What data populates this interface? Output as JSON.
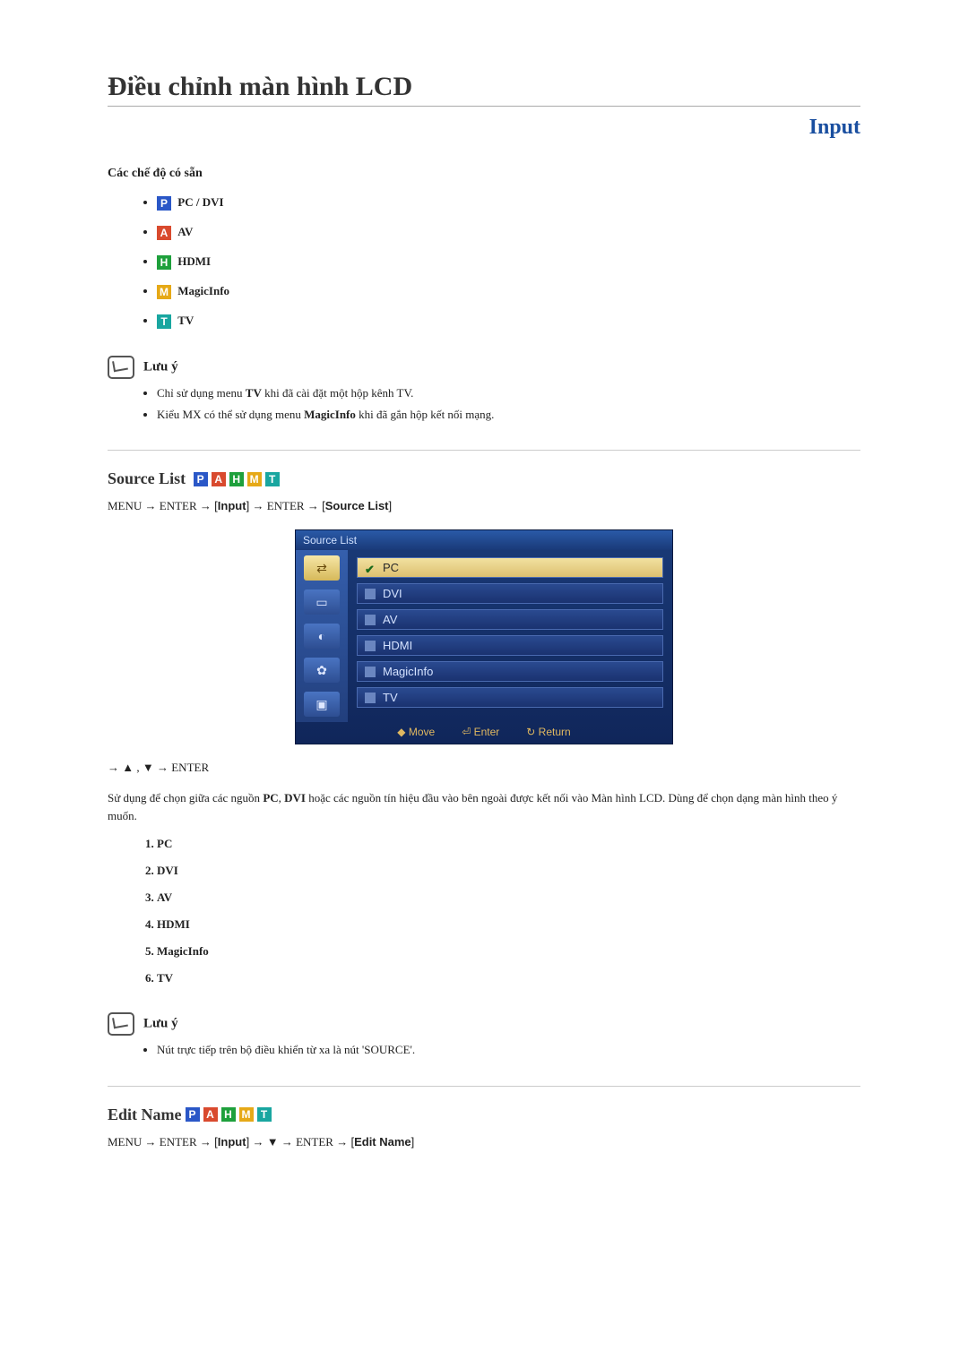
{
  "title": "Điều chỉnh màn hình LCD",
  "inputTitle": "Input",
  "modesHeading": "Các chế độ có sẵn",
  "modes": [
    {
      "key": "P",
      "label": "PC / DVI"
    },
    {
      "key": "A",
      "label": "AV"
    },
    {
      "key": "H",
      "label": "HDMI"
    },
    {
      "key": "M",
      "label": "MagicInfo"
    },
    {
      "key": "T",
      "label": "TV"
    }
  ],
  "note1": {
    "title": "Lưu ý",
    "items": [
      {
        "pre": "Chỉ sử dụng menu ",
        "bold1": "TV",
        "mid": " khi đã cài đặt một hộp kênh TV.",
        "bold2": "",
        "post": ""
      },
      {
        "pre": "Kiểu MX có thể sử dụng menu ",
        "bold1": "MagicInfo",
        "mid": " khi đã gắn hộp kết nối mạng.",
        "bold2": "",
        "post": ""
      }
    ]
  },
  "sourceList": {
    "heading": "Source List",
    "path": {
      "menu": "MENU",
      "enter": "ENTER",
      "input": "Input",
      "item": "Source List"
    },
    "osd": {
      "header": "Source List",
      "items": [
        "PC",
        "DVI",
        "AV",
        "HDMI",
        "MagicInfo",
        "TV"
      ],
      "footer": {
        "move": "Move",
        "enter": "Enter",
        "ret": "Return"
      }
    },
    "arrowLine": "→ ▲ , ▼ → ENTER",
    "description": {
      "pre": "Sử dụng để chọn giữa các nguồn ",
      "b1": "PC",
      "mid1": ", ",
      "b2": "DVI",
      "mid2": " hoặc các nguồn tín hiệu đầu vào bên ngoài được kết nối vào Màn hình LCD. Dùng để chọn dạng màn hình theo ý muốn."
    },
    "list": [
      "PC",
      "DVI",
      "AV",
      "HDMI",
      "MagicInfo",
      "TV"
    ]
  },
  "note2": {
    "title": "Lưu ý",
    "items": [
      {
        "text": "Nút trực tiếp trên bộ điều khiển từ xa là nút 'SOURCE'."
      }
    ]
  },
  "editName": {
    "heading": "Edit Name",
    "path": {
      "menu": "MENU",
      "enter": "ENTER",
      "input": "Input",
      "down": "▼",
      "item": "Edit Name"
    }
  }
}
